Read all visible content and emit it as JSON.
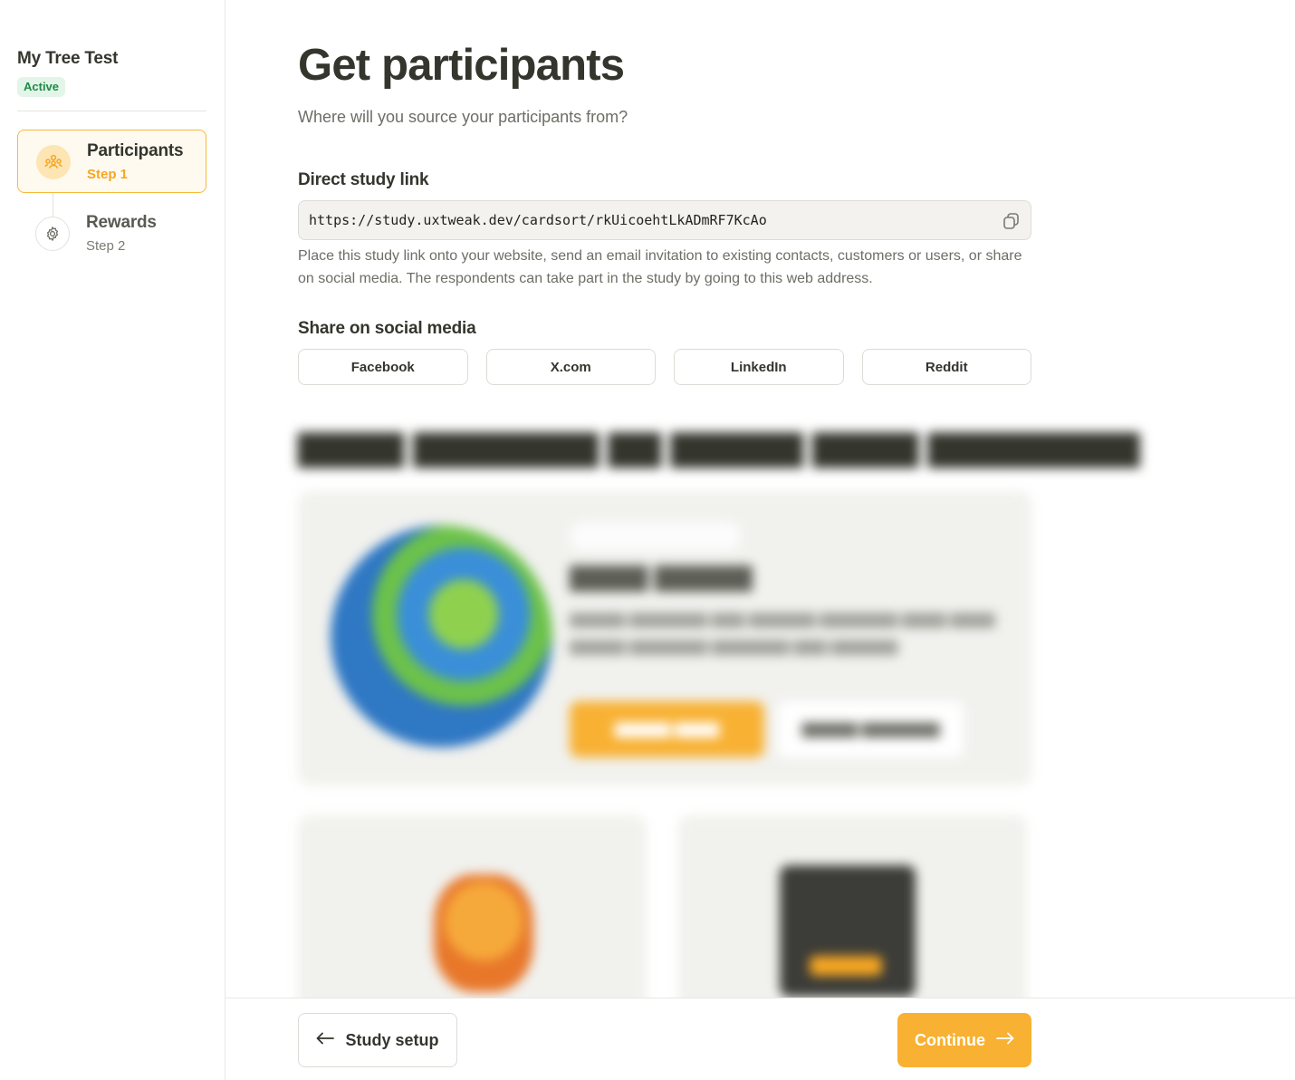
{
  "sidebar": {
    "study_title": "My Tree Test",
    "status": "Active",
    "steps": [
      {
        "label": "Participants",
        "sub": "Step 1",
        "icon": "participants-icon",
        "active": true
      },
      {
        "label": "Rewards",
        "sub": "Step 2",
        "icon": "gear-icon",
        "active": false
      }
    ]
  },
  "main": {
    "title": "Get participants",
    "subtitle": "Where will you source your participants from?",
    "direct_link": {
      "label": "Direct study link",
      "url": "https://study.uxtweak.dev/cardsort/rkUicoehtLkADmRF7KcAo",
      "help": "Place this study link onto your website, send an email invitation to existing contacts, customers or users, or share on social media. The respondents can take part in the study by going to this web address."
    },
    "social": {
      "label": "Share on social media",
      "buttons": [
        "Facebook",
        "X.com",
        "LinkedIn",
        "Reddit"
      ]
    }
  },
  "footer": {
    "back_label": "Study setup",
    "continue_label": "Continue"
  },
  "colors": {
    "accent": "#f8b133",
    "active_badge_bg": "#e3f5e8",
    "active_badge_text": "#1f8a46",
    "text_primary": "#34352d",
    "text_secondary": "#6d6e66"
  }
}
